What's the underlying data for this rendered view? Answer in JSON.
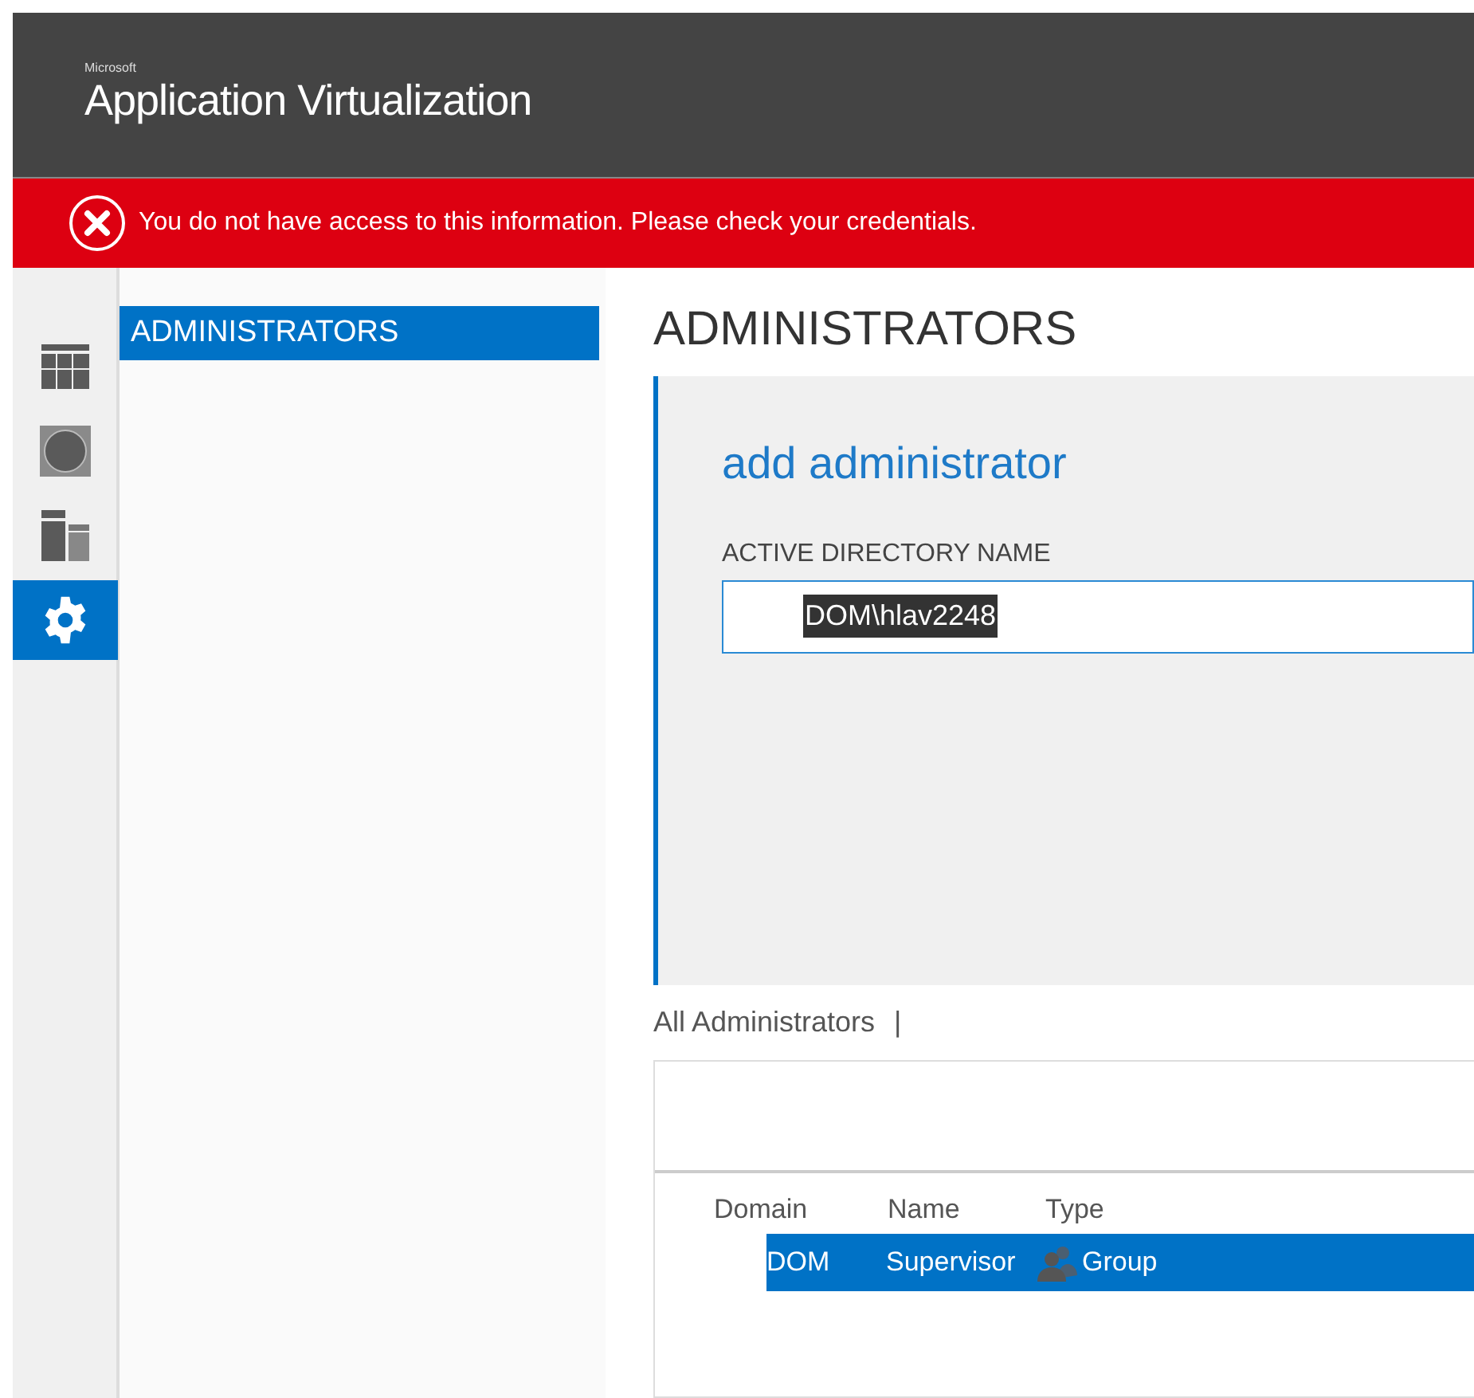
{
  "header": {
    "brand_small": "Microsoft",
    "title": "Application Virtualization"
  },
  "error_banner": {
    "message": "You do not have access to this information. Please check your credentials."
  },
  "rail": [
    {
      "kind": "grid",
      "selected": false
    },
    {
      "kind": "circle",
      "selected": false
    },
    {
      "kind": "layout",
      "selected": false
    },
    {
      "kind": "gear",
      "selected": true
    }
  ],
  "subnav": [
    {
      "label": "ADMINISTRATORS",
      "selected": true
    }
  ],
  "page_title": "ADMINISTRATORS",
  "add_panel": {
    "title": "add administrator",
    "field_label": "ACTIVE DIRECTORY NAME",
    "field_value": "DOM\\hlav2248"
  },
  "list_title": "All Administrators",
  "list_separator": "|",
  "table": {
    "columns": [
      "Domain",
      "Name",
      "Type"
    ],
    "rows": [
      {
        "domain": "DOM",
        "name": "Supervisor",
        "type": "Group",
        "selected": true
      }
    ]
  }
}
